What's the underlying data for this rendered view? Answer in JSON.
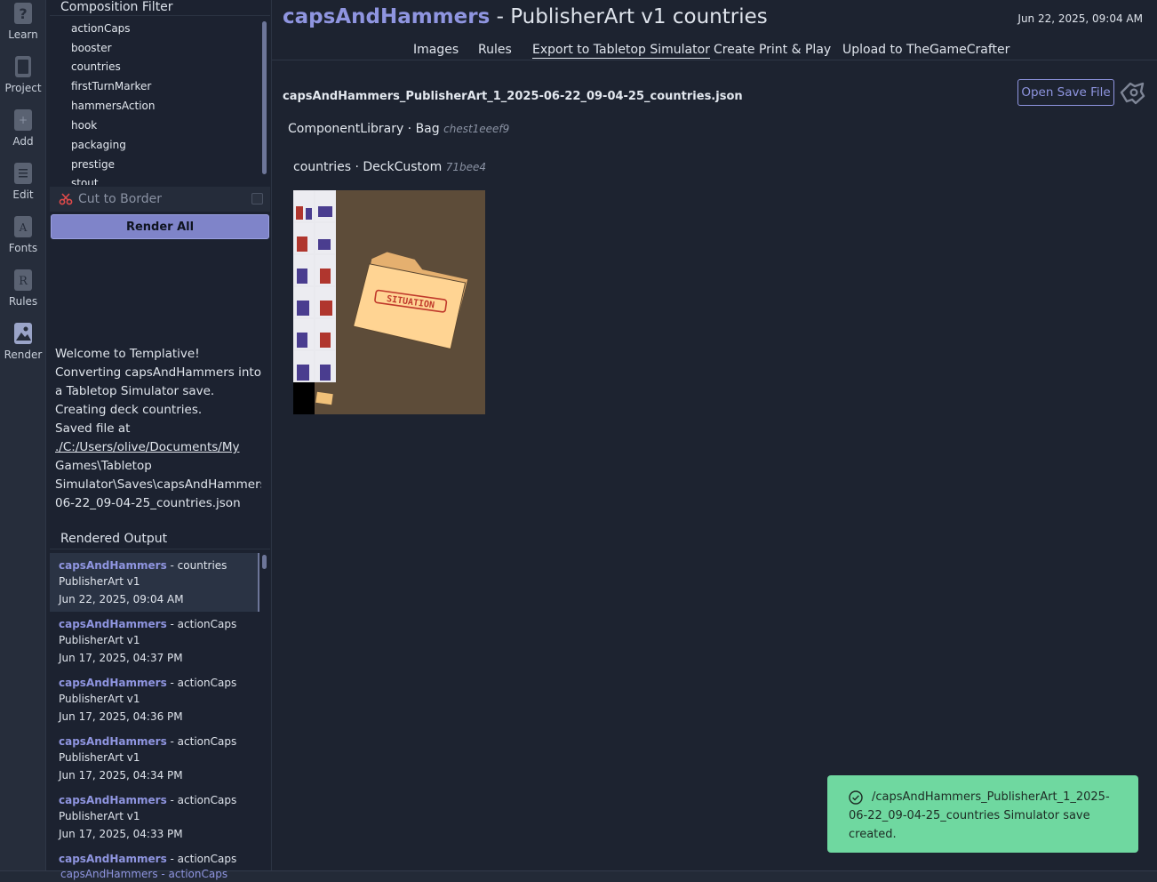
{
  "rail": {
    "items": [
      {
        "label": "Learn",
        "icon": "question-icon"
      },
      {
        "label": "Project",
        "icon": "document-icon"
      },
      {
        "label": "Add",
        "icon": "plus-icon"
      },
      {
        "label": "Edit",
        "icon": "edit-icon"
      },
      {
        "label": "Fonts",
        "icon": "font-icon"
      },
      {
        "label": "Rules",
        "icon": "rules-icon"
      },
      {
        "label": "Render",
        "icon": "image-icon"
      }
    ]
  },
  "sidebar": {
    "filter_title": "Composition Filter",
    "filter_items": [
      "actionCaps",
      "booster",
      "countries",
      "firstTurnMarker",
      "hammersAction",
      "hook",
      "packaging",
      "prestige",
      "stout"
    ],
    "cut_to_border": "Cut to Border",
    "render_all": "Render All",
    "log_lines": [
      "Welcome to Templative!",
      "Converting capsAndHammers into",
      "a Tabletop Simulator save.",
      "Creating deck countries.",
      "Saved file at",
      "./C:/Users/olive/Documents/My",
      "Games\\Tabletop",
      "Simulator\\Saves\\capsAndHammers_P",
      "06-22_09-04-25_countries.json"
    ],
    "rendered_title": "Rendered Output",
    "rendered_items": [
      {
        "project": "capsAndHammers",
        "composition": " - countries",
        "art": "PublisherArt v1",
        "date": "Jun 22, 2025, 09:04 AM"
      },
      {
        "project": "capsAndHammers",
        "composition": " - actionCaps",
        "art": "PublisherArt v1",
        "date": "Jun 17, 2025, 04:37 PM"
      },
      {
        "project": "capsAndHammers",
        "composition": " - actionCaps",
        "art": "PublisherArt v1",
        "date": "Jun 17, 2025, 04:36 PM"
      },
      {
        "project": "capsAndHammers",
        "composition": " - actionCaps",
        "art": "PublisherArt v1",
        "date": "Jun 17, 2025, 04:34 PM"
      },
      {
        "project": "capsAndHammers",
        "composition": " - actionCaps",
        "art": "PublisherArt v1",
        "date": "Jun 17, 2025, 04:33 PM"
      },
      {
        "project": "capsAndHammers",
        "composition": " - actionCaps",
        "art": "",
        "date": ""
      }
    ],
    "bottom_partial": "capsAndHammers - actionCaps"
  },
  "main": {
    "title_project": "capsAndHammers",
    "title_rest": " - PublisherArt v1 countries",
    "timestamp": "Jun 22, 2025, 09:04 AM",
    "tabs": [
      "Images",
      "Rules",
      "Export to Tabletop Simulator",
      "Create Print & Play",
      "Upload to TheGameCrafter"
    ],
    "active_tab": "Export to Tabletop Simulator",
    "file_name": "capsAndHammers_PublisherArt_1_2025-06-22_09-04-25_countries.json",
    "open_save_label": "Open Save File",
    "component_library": "ComponentLibrary · Bag",
    "component_hash": "chest1eeef9",
    "deck_label": "countries · DeckCustom",
    "deck_hash": "71bee4",
    "card_back_text": "SITUATION"
  },
  "toast": {
    "message": "/capsAndHammers_PublisherArt_1_2025-06-22_09-04-25_countries Simulator save created."
  },
  "colors": {
    "accent": "#8f95e0",
    "toast": "#6fd8a0",
    "background": "#1d2330"
  }
}
